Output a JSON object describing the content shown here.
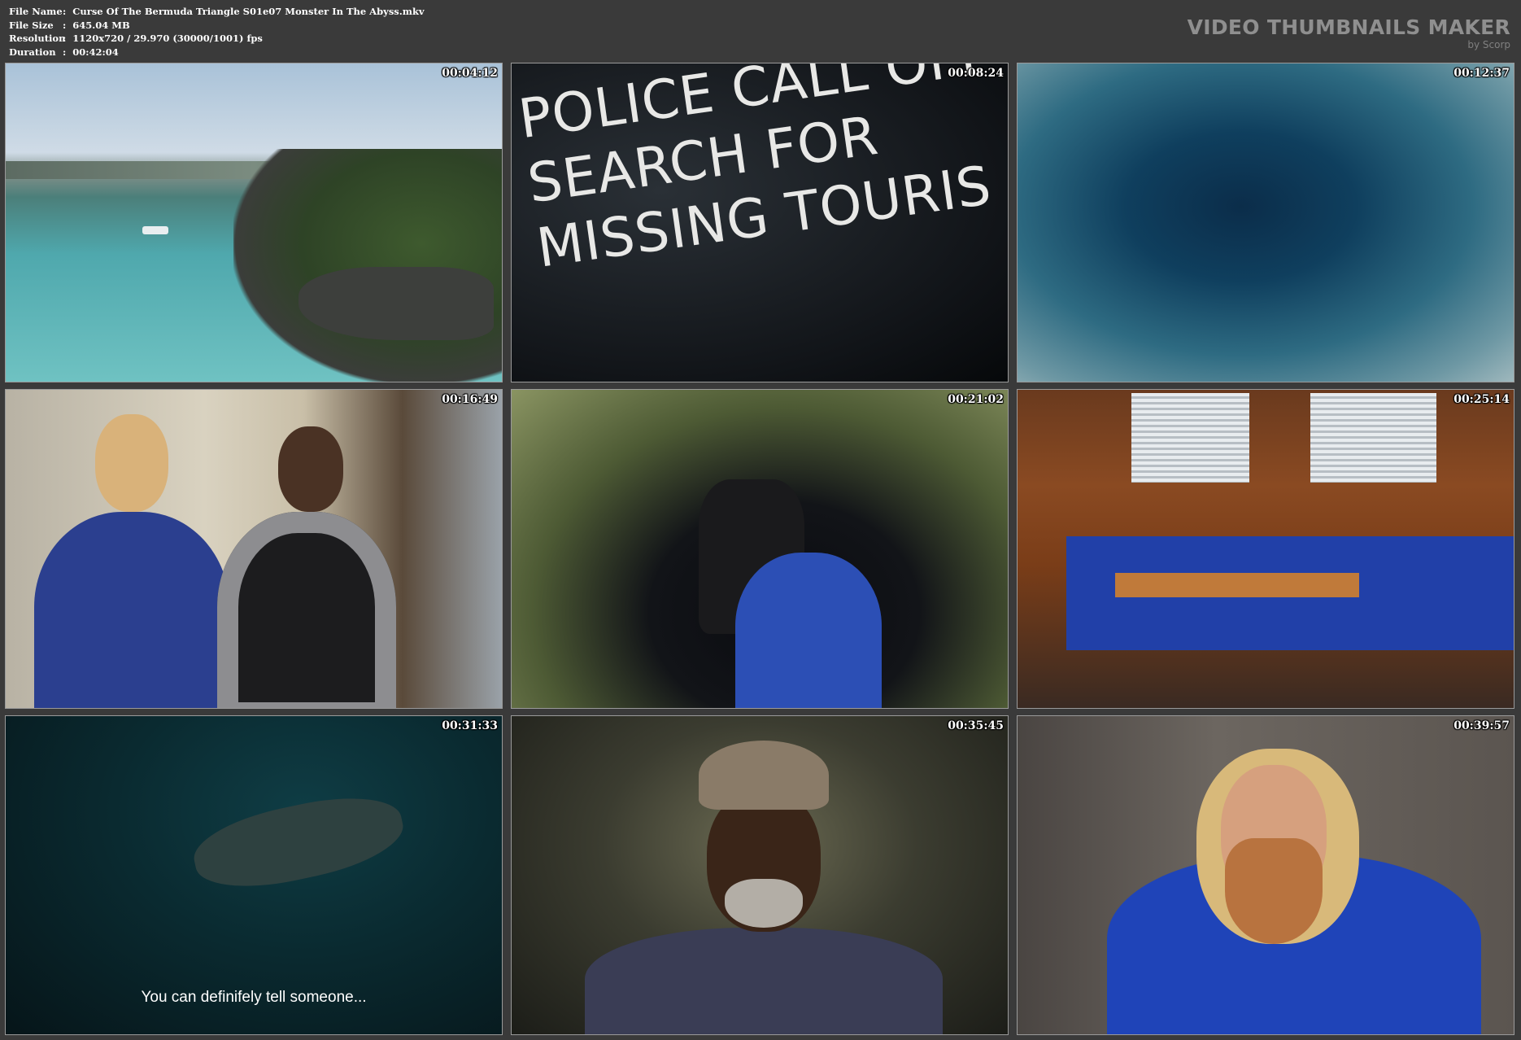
{
  "file_info": [
    {
      "key": "File Name",
      "value": "Curse Of The Bermuda Triangle S01e07 Monster In The Abyss.mkv"
    },
    {
      "key": "File Size",
      "value": "645.04 MB"
    },
    {
      "key": "Resolution",
      "value": "1120x720 / 29.970 (30000/1001) fps"
    },
    {
      "key": "Duration",
      "value": "00:42:04"
    }
  ],
  "separator": ":",
  "brand": {
    "title": "VIDEO THUMBNAILS MAKER",
    "subtitle": "by Scorp"
  },
  "thumbnails": [
    {
      "timestamp": "00:04:12"
    },
    {
      "timestamp": "00:08:24",
      "headline": [
        "POLICE CALL OFF",
        "SEARCH FOR",
        "MISSING TOURIS"
      ]
    },
    {
      "timestamp": "00:12:37"
    },
    {
      "timestamp": "00:16:49"
    },
    {
      "timestamp": "00:21:02"
    },
    {
      "timestamp": "00:25:14"
    },
    {
      "timestamp": "00:31:33",
      "subtitle": "You can definifely tell someone..."
    },
    {
      "timestamp": "00:35:45"
    },
    {
      "timestamp": "00:39:57"
    }
  ]
}
